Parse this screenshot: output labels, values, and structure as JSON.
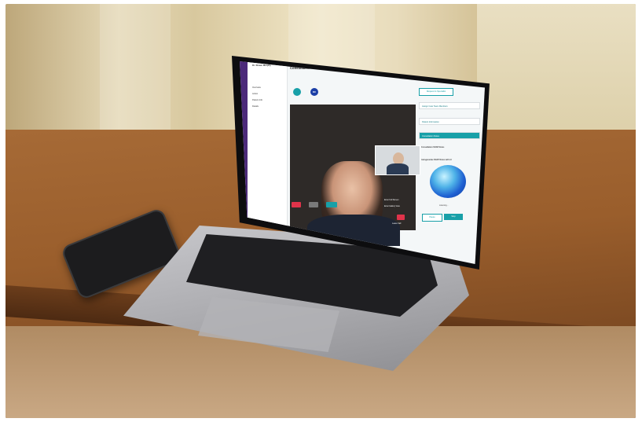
{
  "scene": {
    "colors": {
      "wall": "#e4d8b6",
      "desk": "#9a5e2c",
      "accent": "#18a0a8",
      "app_rail": "#4c2a7a"
    }
  },
  "app": {
    "title": "Consultation for Louise Smith",
    "doctor_name": "Dr. Shaun Murphy",
    "sidebar_items": [
      "Overview",
      "Action",
      "Patient Info",
      "Details"
    ],
    "avatar_initials": "DC",
    "right_panel": {
      "invite_button": "Request to Specialist",
      "rows": [
        "Assign Care Team Members",
        "Patient Information",
        "Consultation Notes"
      ],
      "notes_heading": "Consultation SOAP Notes",
      "ai_heading": "Autogenerate SOAP Notes with AI",
      "listening_label": "Listening...",
      "pause_button": "Pause",
      "stop_button": "Stop"
    },
    "video_controls": {
      "enter_full_screen": "Enter Full Screen",
      "enter_gallery_view": "Enter Gallery View",
      "leave_call": "Leave Call"
    }
  }
}
